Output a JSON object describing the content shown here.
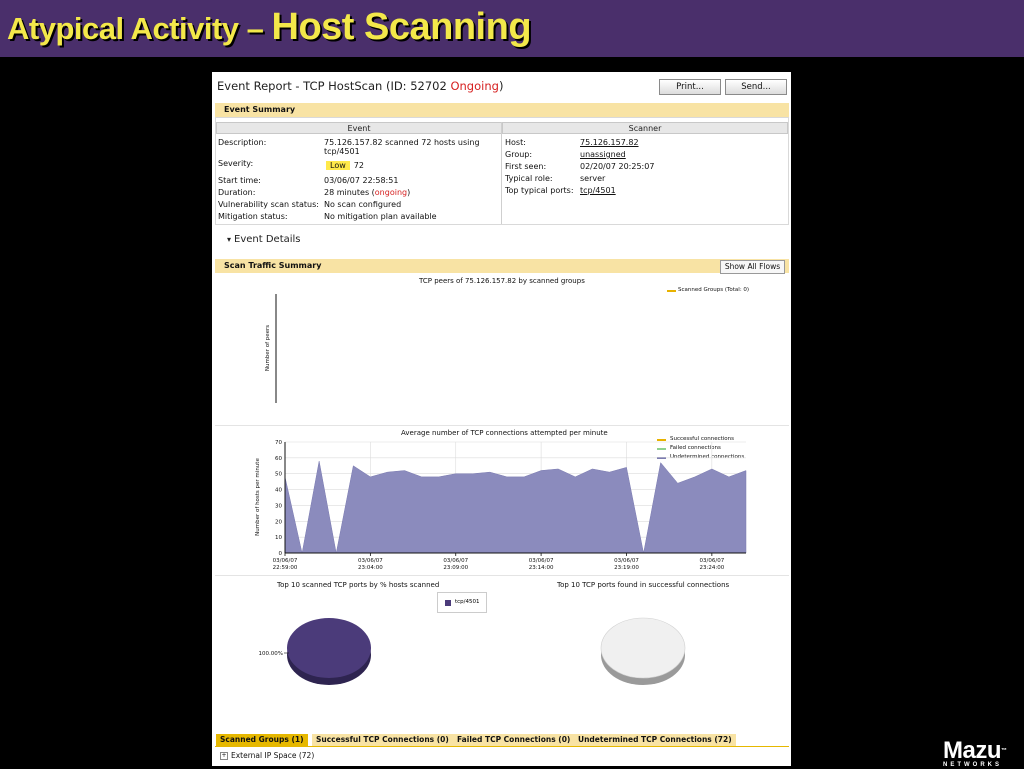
{
  "slide": {
    "title_part1": "Atypical Activity – ",
    "title_part2": "Host Scanning",
    "logo_text": "Mazu",
    "logo_tm": "™",
    "logo_sub": "NETWORKS"
  },
  "report": {
    "title_prefix": "Event Report - TCP HostScan (ID: 52702 ",
    "title_status": "Ongoing",
    "title_suffix": ")",
    "print_button": "Print...",
    "send_button": "Send..."
  },
  "event_summary": {
    "bar_label": "Event Summary",
    "event_header": "Event",
    "scanner_header": "Scanner",
    "event_fields": {
      "description_label": "Description:",
      "description_line1": "75.126.157.82 scanned 72 hosts using",
      "description_line2": "tcp/4501",
      "severity_label": "Severity:",
      "severity_badge": "Low",
      "severity_value": "72",
      "start_label": "Start time:",
      "start_value": "03/06/07 22:58:51",
      "duration_label": "Duration:",
      "duration_value": "28 minutes (",
      "duration_status": "ongoing",
      "duration_end": ")",
      "vuln_label": "Vulnerability scan status:",
      "vuln_value": "No scan configured",
      "mitigation_label": "Mitigation status:",
      "mitigation_value": "No mitigation plan available"
    },
    "scanner_fields": {
      "host_label": "Host:",
      "host_value": "75.126.157.82",
      "group_label": "Group:",
      "group_value": "unassigned",
      "first_seen_label": "First seen:",
      "first_seen_value": "02/20/07 20:25:07",
      "role_label": "Typical role:",
      "role_value": "server",
      "ports_label": "Top typical ports:",
      "ports_value": "tcp/4501"
    }
  },
  "event_details": {
    "toggle_glyph": "▾",
    "label": "Event Details"
  },
  "scan_traffic": {
    "bar_label": "Scan Traffic Summary",
    "show_all_button": "Show All Flows"
  },
  "colors": {
    "area_fill": "#8b8bbd",
    "successful": "#e8b200",
    "failed": "#8fd28f",
    "undetermined": "#6e6eaa",
    "pie_filled": "#4b3b7a",
    "pie_filled_side": "#2e2450",
    "pie_empty": "#f0f0f0",
    "pie_empty_side": "#9a9a9a"
  },
  "chart_data": [
    {
      "type": "bar",
      "title": "TCP peers of 75.126.157.82 by scanned groups",
      "ylabel": "Number of peers",
      "xlabel": "",
      "legend": [
        {
          "name": "Scanned Groups (Total: 0)"
        }
      ],
      "legend_position": "top-right",
      "categories": [],
      "values": []
    },
    {
      "type": "area",
      "title": "Average number of TCP connections attempted per minute",
      "ylabel": "Number of hosts per minute",
      "xlabel": "",
      "ylim": [
        0,
        70
      ],
      "yticks": [
        0,
        10,
        20,
        30,
        40,
        50,
        60,
        70
      ],
      "grid": true,
      "legend_position": "top-right",
      "x_ticks": [
        {
          "minute": 0,
          "date": "03/06/07",
          "time": "22:59:00"
        },
        {
          "minute": 5,
          "date": "03/06/07",
          "time": "23:04:00"
        },
        {
          "minute": 10,
          "date": "03/06/07",
          "time": "23:09:00"
        },
        {
          "minute": 15,
          "date": "03/06/07",
          "time": "23:14:00"
        },
        {
          "minute": 20,
          "date": "03/06/07",
          "time": "23:19:00"
        },
        {
          "minute": 25,
          "date": "03/06/07",
          "time": "23:24:00"
        }
      ],
      "x_minutes": [
        0,
        1,
        2,
        3,
        4,
        5,
        6,
        7,
        8,
        9,
        10,
        11,
        12,
        13,
        14,
        15,
        16,
        17,
        18,
        19,
        20,
        21,
        22,
        23,
        24,
        25,
        26,
        27
      ],
      "series": [
        {
          "name": "Successful connections",
          "values": []
        },
        {
          "name": "Failed connections",
          "values": []
        },
        {
          "name": "Undetermined connections",
          "values": [
            48,
            0,
            58,
            0,
            55,
            48,
            51,
            52,
            48,
            48,
            50,
            50,
            51,
            48,
            48,
            52,
            53,
            48,
            53,
            51,
            54,
            0,
            57,
            44,
            48,
            53,
            48,
            52
          ]
        }
      ]
    },
    {
      "type": "pie",
      "title": "Top 10 scanned TCP ports by % hosts scanned",
      "legend": [
        {
          "name": "tcp/4501"
        }
      ],
      "slices": [
        {
          "label": "tcp/4501",
          "value": 100,
          "value_label": "100.00%"
        }
      ]
    },
    {
      "type": "pie",
      "title": "Top 10 TCP ports found in successful connections",
      "slices": []
    }
  ],
  "tabs": [
    {
      "label": "Scanned Groups (1)",
      "active": true
    },
    {
      "label": "Successful TCP Connections (0)",
      "active": false
    },
    {
      "label": "Failed TCP Connections (0)",
      "active": false
    },
    {
      "label": "Undetermined TCP Connections (72)",
      "active": false
    }
  ],
  "tree": {
    "toggle": "+",
    "row_label": "External IP Space (72)"
  }
}
